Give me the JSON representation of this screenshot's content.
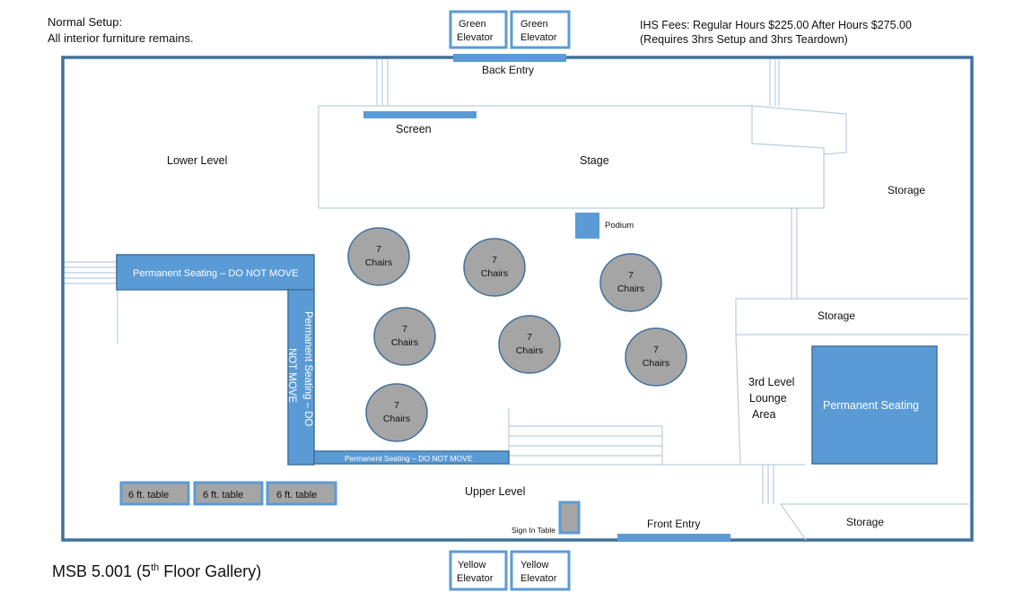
{
  "header": {
    "setup_title": "Normal Setup:",
    "setup_note": "All interior furniture remains.",
    "fees_line1": "IHS Fees:  Regular Hours $225.00  After Hours $275.00",
    "fees_line2": "(Requires 3hrs Setup and 3hrs Teardown)"
  },
  "elevators": {
    "green": [
      {
        "line1": "Green",
        "line2": "Elevator"
      },
      {
        "line1": "Green",
        "line2": "Elevator"
      }
    ],
    "yellow": [
      {
        "line1": "Yellow",
        "line2": "Elevator"
      },
      {
        "line1": "Yellow",
        "line2": "Elevator"
      }
    ]
  },
  "areas": {
    "back_entry": "Back Entry",
    "front_entry": "Front Entry",
    "screen": "Screen",
    "stage": "Stage",
    "lower_level": "Lower Level",
    "upper_level": "Upper Level",
    "storage_right": "Storage",
    "storage_middle": "Storage",
    "storage_bottom": "Storage",
    "podium": "Podium",
    "lounge_line1": "3rd Level",
    "lounge_line2": "Lounge",
    "lounge_line3": "Area",
    "sign_in_table": "Sign In Table"
  },
  "seating": {
    "perm_top": "Permanent Seating – DO NOT MOVE",
    "perm_vertical_line1": "Permanent Seating – DO",
    "perm_vertical_line2": "NOT MOVE",
    "perm_bottom": "Permanent Seating – DO NOT MOVE",
    "perm_right": "Permanent Seating"
  },
  "tables": [
    {
      "count": "7",
      "label": "Chairs"
    },
    {
      "count": "7",
      "label": "Chairs"
    },
    {
      "count": "7",
      "label": "Chairs"
    },
    {
      "count": "7",
      "label": "Chairs"
    },
    {
      "count": "7",
      "label": "Chairs"
    },
    {
      "count": "7",
      "label": "Chairs"
    },
    {
      "count": "7",
      "label": "Chairs"
    }
  ],
  "six_ft_tables": [
    "6 ft. table",
    "6 ft. table",
    "6 ft. table"
  ],
  "footer": {
    "room_title": "MSB 5.001 (5",
    "room_sup": "th",
    "room_suffix": " Floor Gallery)"
  },
  "colors": {
    "accent": "#5b9bd5",
    "border": "#41719c",
    "table_fill": "#a5a5a5",
    "line": "#b9cde0"
  }
}
